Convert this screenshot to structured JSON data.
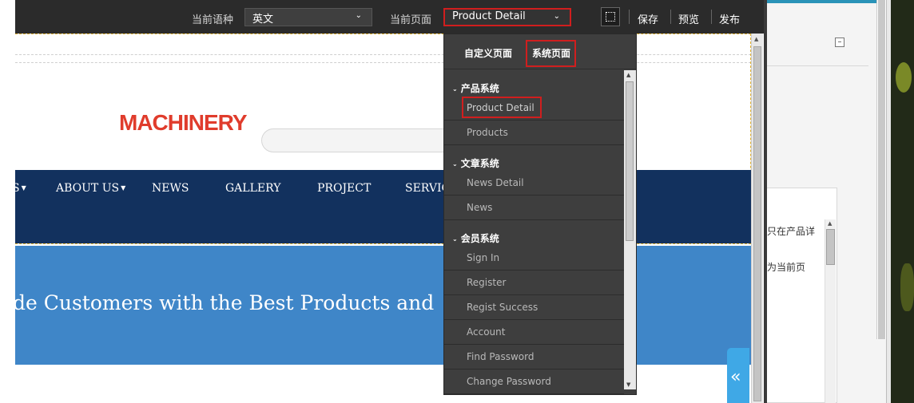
{
  "toolbar": {
    "language_label": "当前语种",
    "language_value": "英文",
    "page_label": "当前页面",
    "page_value": "Product Detail",
    "save": "保存",
    "preview": "预览",
    "publish": "发布"
  },
  "dropdown": {
    "tabs": [
      {
        "label": "自定义页面",
        "active": false
      },
      {
        "label": "系统页面",
        "active": true
      }
    ],
    "groups": [
      {
        "title": "产品系统",
        "items": [
          "Product Detail",
          "Products"
        ]
      },
      {
        "title": "文章系统",
        "items": [
          "News Detail",
          "News"
        ]
      },
      {
        "title": "会员系统",
        "items": [
          "Sign In",
          "Register",
          "Regist Success",
          "Account",
          "Find Password",
          "Change Password"
        ]
      }
    ],
    "selected_item": "Product Detail"
  },
  "site": {
    "logo_text": "MACHINERY",
    "nav": [
      {
        "label": "S",
        "has_caret": true
      },
      {
        "label": "ABOUT US",
        "has_caret": true
      },
      {
        "label": "NEWS",
        "has_caret": false
      },
      {
        "label": "GALLERY",
        "has_caret": false
      },
      {
        "label": "PROJECT",
        "has_caret": false
      },
      {
        "label": "SERVIC",
        "has_caret": false
      }
    ],
    "banner_text": "de Customers with the Best Products and"
  },
  "right_panel": {
    "text_line1": "只在产品详",
    "text_line2": "为当前页"
  },
  "colors": {
    "toolbar_bg": "#2b2b2b",
    "dropdown_bg": "#3e3e3e",
    "nav_bg": "#12315e",
    "banner_bg": "#3f86c8",
    "logo_red": "#e03c2c",
    "highlight_red": "#d01e1e",
    "collapse_tab": "#3fa8e6"
  },
  "icons": [
    "select-region-icon",
    "chevron-down-icon",
    "caret-down-icon",
    "double-chevron-left-icon",
    "minus-icon",
    "scroll-up-icon",
    "scroll-down-icon"
  ]
}
